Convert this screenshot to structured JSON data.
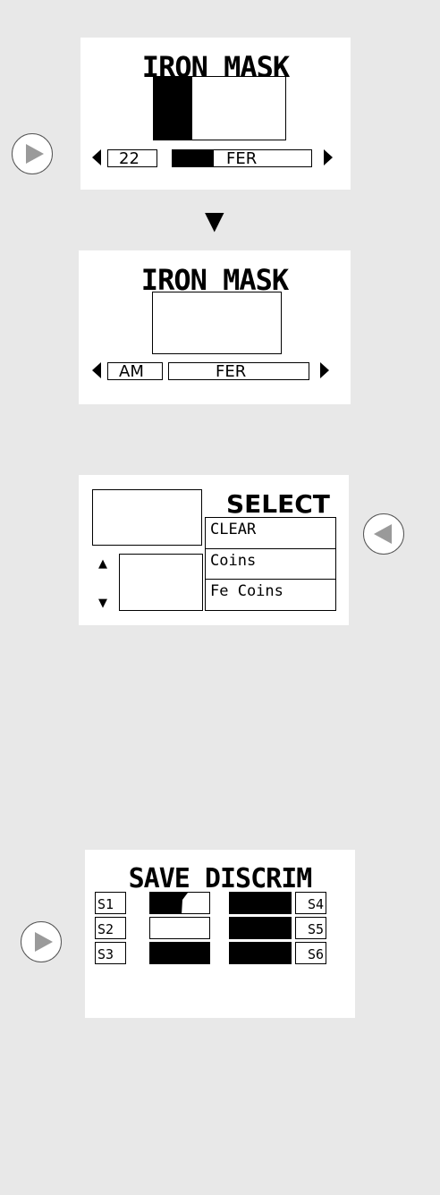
{
  "panel1": {
    "title": "IRON MASK",
    "value": "22",
    "field": "FER"
  },
  "down_arrow": "▼",
  "panel2": {
    "title": "IRON MASK",
    "value": "AM",
    "field": "FER"
  },
  "panel3": {
    "title": "SELECT",
    "items": [
      "CLEAR",
      "Coins",
      "Fe Coins"
    ]
  },
  "panel4": {
    "title": "SAVE DISCRIM",
    "left_slots": [
      "S1",
      "S2",
      "S3"
    ],
    "right_slots": [
      "S4",
      "S5",
      "S6"
    ]
  },
  "icons": {
    "play_right": "play-right-icon",
    "play_left": "play-left-icon",
    "triangle_left": "triangle-left-icon",
    "triangle_right": "triangle-right-icon",
    "up": "up-triangle-icon",
    "down": "down-triangle-icon"
  },
  "colors": {
    "background": "#e8e8e8",
    "panel": "#ffffff",
    "button_icon": "#9a9a9a"
  }
}
